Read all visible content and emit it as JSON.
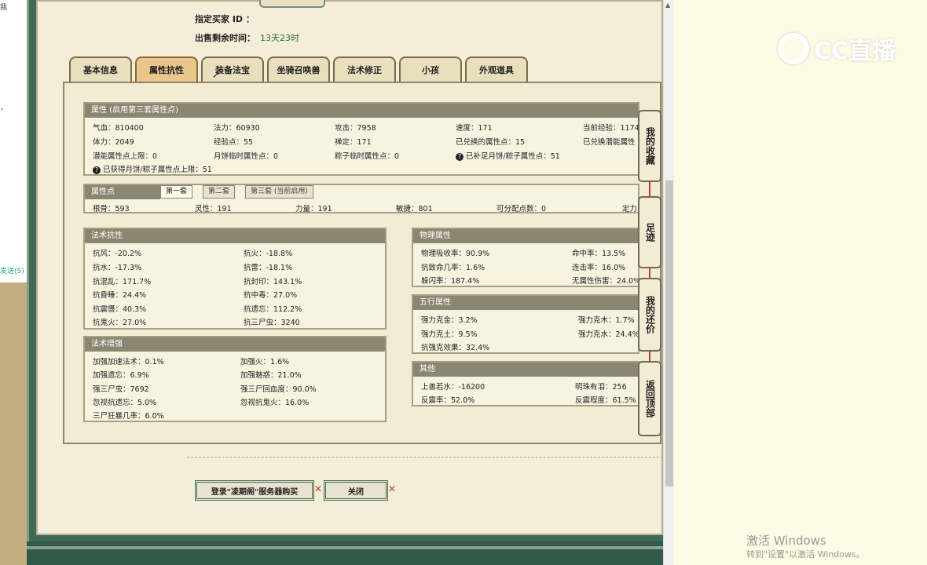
{
  "left_fragments": {
    "a": "我",
    "b": "，",
    "c": "发送(S)"
  },
  "header": {
    "buyer_id_label": "指定买家 ID ：",
    "remaining_label": "出售剩余时间：",
    "remaining_value": "13天23时"
  },
  "tabs": [
    {
      "label": "基本信息",
      "active": false
    },
    {
      "label": "属性抗性",
      "active": true
    },
    {
      "label": "装备法宝",
      "active": false
    },
    {
      "label": "坐骑召唤兽",
      "active": false
    },
    {
      "label": "法术修正",
      "active": false
    },
    {
      "label": "小孩",
      "active": false
    },
    {
      "label": "外观道具",
      "active": false
    }
  ],
  "attributes": {
    "title": "属性 (启用第三套属性点)",
    "rows": [
      [
        "气血：810400",
        "法力：60930",
        "攻击：7958",
        "速度：171",
        "当前经验：1174"
      ],
      [
        "体力：2049",
        "经验点：55",
        "禅定：171",
        "已兑换的属性点：15",
        "已兑换潜能属性"
      ],
      [
        "潜能属性点上限：0",
        "月饼临时属性点：0",
        "粽子临时属性点：0",
        "已补足月饼/粽子属性点：51",
        ""
      ]
    ],
    "footnote": "已获得月饼/粽子属性点上限：51"
  },
  "points": {
    "title": "属性点",
    "subtabs": [
      "第一套",
      "第二套",
      "第三套 (当前启用)"
    ],
    "values": [
      "根骨：593",
      "灵性：191",
      "力量：191",
      "敏捷：801",
      "可分配点数：0",
      "定力"
    ]
  },
  "resist": {
    "title": "法术抗性",
    "rows": [
      [
        "抗风：-20.2%",
        "抗火：-18.8%"
      ],
      [
        "抗水：-17.3%",
        "抗雷：-18.1%"
      ],
      [
        "抗混乱：171.7%",
        "抗封印：143.1%"
      ],
      [
        "抗昏睡：24.4%",
        "抗中毒：27.0%"
      ],
      [
        "抗震慑：40.3%",
        "抗遗忘：112.2%"
      ],
      [
        "抗鬼火：27.0%",
        "抗三尸虫：3240"
      ]
    ]
  },
  "enhance": {
    "title": "法术增强",
    "rows": [
      [
        "加强加速法术：0.1%",
        "加强火：1.6%"
      ],
      [
        "加强遗忘：6.9%",
        "加强魅惑：21.0%"
      ],
      [
        "强三尸虫：7692",
        "强三尸回血度：90.0%"
      ],
      [
        "忽视抗遗忘：5.0%",
        "忽视抗鬼火：16.0%"
      ],
      [
        "三尸狂暴几率：6.0%",
        ""
      ]
    ]
  },
  "physical": {
    "title": "物理属性",
    "rows": [
      [
        "物理吸收率：90.9%",
        "命中率：13.5%"
      ],
      [
        "抗致命几率：1.6%",
        "连击率：16.0%"
      ],
      [
        "躲闪率：187.4%",
        "无属性伤害：24.0%"
      ]
    ]
  },
  "five": {
    "title": "五行属性",
    "rows": [
      [
        "强力克金：3.2%",
        "强力克木：1.7%"
      ],
      [
        "强力克土：9.5%",
        "强力克水：24.4%"
      ],
      [
        "抗强克效果：32.4%",
        ""
      ]
    ]
  },
  "other": {
    "title": "其他",
    "rows": [
      [
        "上善若水：-16200",
        "明珠有泪：256"
      ],
      [
        "反震率：52.0%",
        "反震程度：61.5%"
      ]
    ]
  },
  "side_buttons": [
    "我的收藏",
    "足迹",
    "我的还价",
    "返回顶部"
  ],
  "buttons": {
    "login_buy": "登录\"凌期阁\"服务器购买",
    "close": "关闭"
  },
  "logo_text": "CC直播",
  "watermark": {
    "line1": "激活 Windows",
    "line2": "转到\"设置\"以激活 Windows。"
  },
  "colors": {
    "frame": "#3f6b56",
    "panel": "#f4eed8",
    "header": "#8b8670",
    "active_tab": "#e9c78a"
  }
}
